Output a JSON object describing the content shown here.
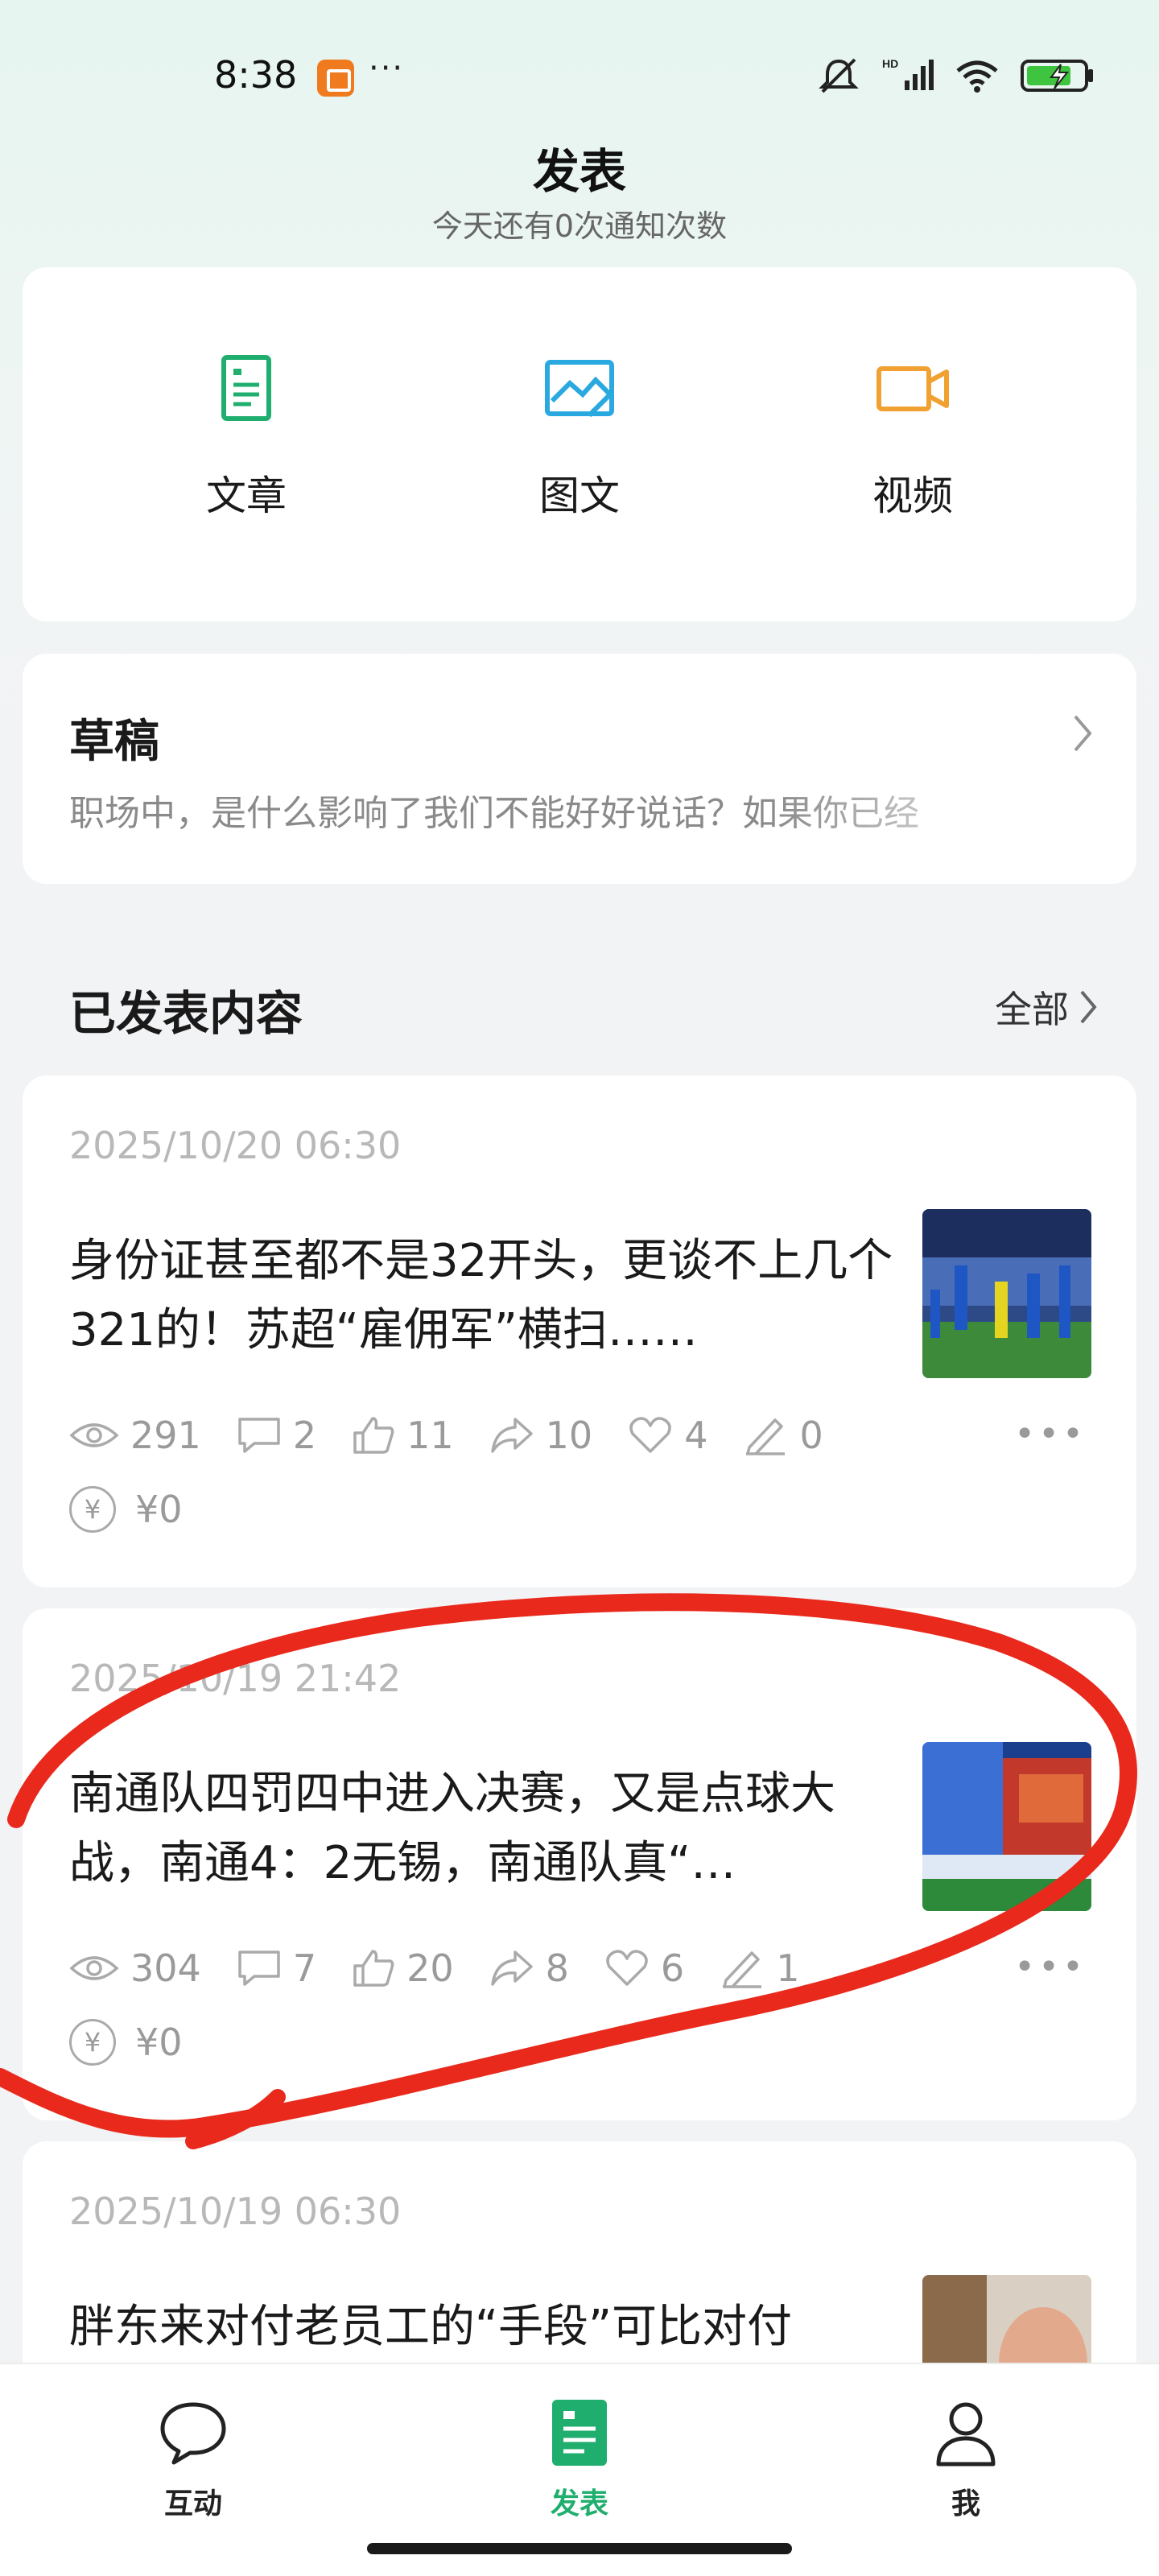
{
  "status_bar": {
    "time": "8:38",
    "dots": "···"
  },
  "header": {
    "title": "发表",
    "subtitle": "今天还有0次通知次数"
  },
  "publish_options": [
    {
      "label": "文章",
      "icon": "article-icon",
      "color": "#1fae6e"
    },
    {
      "label": "图文",
      "icon": "image-text-icon",
      "color": "#2aa8e0"
    },
    {
      "label": "视频",
      "icon": "video-icon",
      "color": "#f0a132"
    }
  ],
  "draft": {
    "title": "草稿",
    "preview": "职场中，是什么影响了我们不能好好说话？如果你已经"
  },
  "published": {
    "title": "已发表内容",
    "more_label": "全部"
  },
  "posts": [
    {
      "date": "2025/10/20 06:30",
      "title": "身份证甚至都不是32开头，更谈不上几个321的！苏超“雇佣军”横扫……",
      "views": "291",
      "comments": "2",
      "likes": "11",
      "shares": "10",
      "favorites": "4",
      "edits": "0",
      "income": "¥0",
      "yen": "¥"
    },
    {
      "date": "2025/10/19 21:42",
      "title": "南通队四罚四中进入决赛，又是点球大战，南通4：2无锡，南通队真“…",
      "views": "304",
      "comments": "7",
      "likes": "20",
      "shares": "8",
      "favorites": "6",
      "edits": "1",
      "income": "¥0",
      "yen": "¥"
    },
    {
      "date": "2025/10/19 06:30",
      "title": "胖东来对付老员工的“手段”可比对付"
    }
  ],
  "bottom_nav": [
    {
      "label": "互动",
      "icon": "chat-icon"
    },
    {
      "label": "发表",
      "icon": "publish-icon",
      "active": true
    },
    {
      "label": "我",
      "icon": "profile-icon"
    }
  ],
  "colors": {
    "accent": "#1fae6e",
    "annotation": "#e8291c"
  }
}
